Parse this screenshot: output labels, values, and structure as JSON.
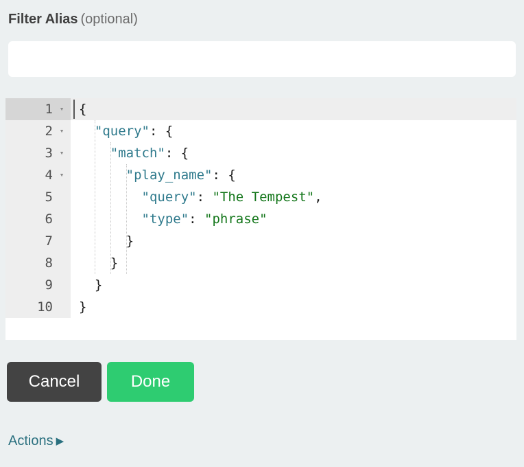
{
  "heading": {
    "label": "Filter Alias",
    "optional_suffix": "(optional)"
  },
  "alias_input": {
    "value": "",
    "placeholder": ""
  },
  "editor": {
    "language": "json",
    "active_line": 1,
    "lines": [
      {
        "number": "1",
        "fold": "▾",
        "tokens": [
          {
            "text": "{",
            "type": "punct"
          }
        ]
      },
      {
        "number": "2",
        "fold": "▾",
        "tokens": [
          {
            "text": "  ",
            "type": "punct"
          },
          {
            "text": "\"query\"",
            "type": "key"
          },
          {
            "text": ": {",
            "type": "punct"
          }
        ]
      },
      {
        "number": "3",
        "fold": "▾",
        "tokens": [
          {
            "text": "    ",
            "type": "punct"
          },
          {
            "text": "\"match\"",
            "type": "key"
          },
          {
            "text": ": {",
            "type": "punct"
          }
        ]
      },
      {
        "number": "4",
        "fold": "▾",
        "tokens": [
          {
            "text": "      ",
            "type": "punct"
          },
          {
            "text": "\"play_name\"",
            "type": "key"
          },
          {
            "text": ": {",
            "type": "punct"
          }
        ]
      },
      {
        "number": "5",
        "fold": "",
        "tokens": [
          {
            "text": "        ",
            "type": "punct"
          },
          {
            "text": "\"query\"",
            "type": "key"
          },
          {
            "text": ": ",
            "type": "punct"
          },
          {
            "text": "\"The Tempest\"",
            "type": "str"
          },
          {
            "text": ",",
            "type": "punct"
          }
        ]
      },
      {
        "number": "6",
        "fold": "",
        "tokens": [
          {
            "text": "        ",
            "type": "punct"
          },
          {
            "text": "\"type\"",
            "type": "key"
          },
          {
            "text": ": ",
            "type": "punct"
          },
          {
            "text": "\"phrase\"",
            "type": "str"
          }
        ]
      },
      {
        "number": "7",
        "fold": "",
        "tokens": [
          {
            "text": "      }",
            "type": "punct"
          }
        ]
      },
      {
        "number": "8",
        "fold": "",
        "tokens": [
          {
            "text": "    }",
            "type": "punct"
          }
        ]
      },
      {
        "number": "9",
        "fold": "",
        "tokens": [
          {
            "text": "  }",
            "type": "punct"
          }
        ]
      },
      {
        "number": "10",
        "fold": "",
        "tokens": [
          {
            "text": "}",
            "type": "punct"
          }
        ]
      }
    ]
  },
  "buttons": {
    "cancel_label": "Cancel",
    "done_label": "Done"
  },
  "actions": {
    "label": "Actions",
    "caret": "▶"
  },
  "colors": {
    "page_background": "#ecf0f1",
    "key_token": "#2f7a8c",
    "string_token": "#13761a",
    "punct_token": "#1a1a1a",
    "gutter_background": "#eeeeee",
    "active_gutter_background": "#d6d6d6",
    "active_line_background": "#eeeeee",
    "cancel_button": "#434343",
    "done_button": "#2ecc71",
    "actions_link": "#2a707f"
  }
}
